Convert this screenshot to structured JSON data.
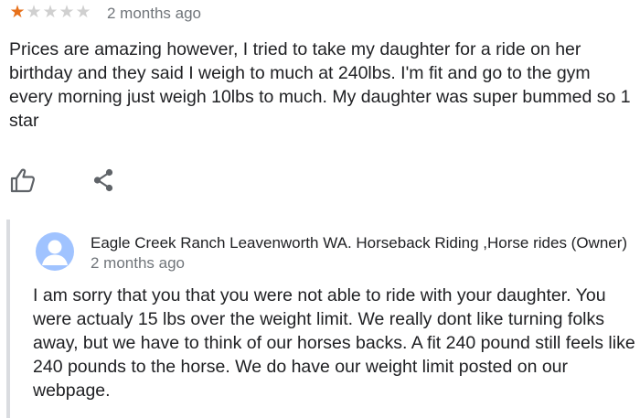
{
  "review": {
    "rating": 1,
    "max_rating": 5,
    "date": "2 months ago",
    "text": "Prices are amazing however, I tried to take my daughter for a ride on her birthday and they said I weigh to much at 240lbs. I'm fit and go to the gym every morning just weigh 10lbs to much. My daughter was super bummed so 1 star",
    "actions": {
      "like_icon": "thumbs-up-icon",
      "share_icon": "share-icon"
    }
  },
  "owner_reply": {
    "avatar_icon": "person-avatar-icon",
    "name": "Eagle Creek Ranch Leavenworth WA. Horseback Riding ,Horse rides (Owner)",
    "date": "2 months ago",
    "text": "I am sorry that you that you were not able to ride with your daughter. You were actualy 15 lbs over the weight limit. We really dont like turning folks away, but we have to think of our horses backs. A fit 240 pound still feels like 240 pounds to the horse. We do have our weight limit posted on our webpage."
  },
  "colors": {
    "star_filled": "#e7711b",
    "star_empty": "#d0d0d0",
    "avatar_bg": "#a0c3ff",
    "avatar_fg": "#ffffff",
    "secondary_text": "#70757a",
    "reply_border": "#dadce0"
  }
}
